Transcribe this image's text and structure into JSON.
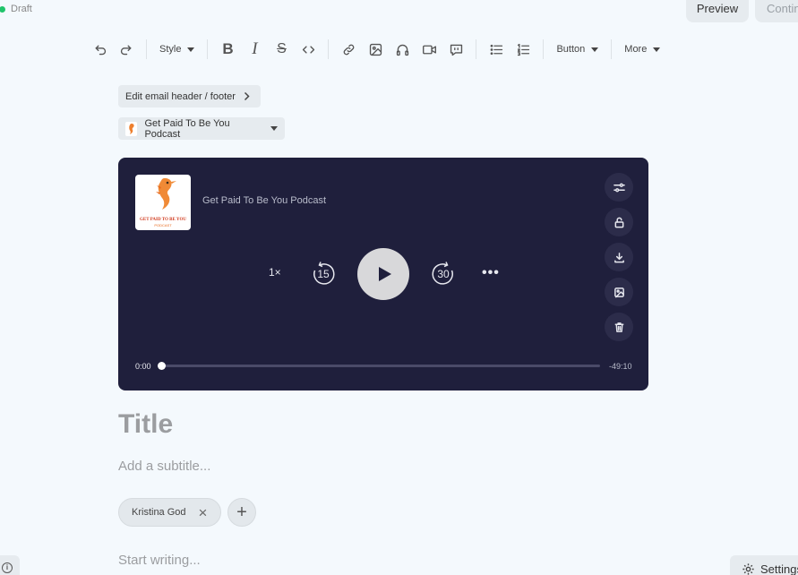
{
  "status": {
    "label": "Draft",
    "dot_color": "#20c46b"
  },
  "header": {
    "preview_label": "Preview",
    "continue_label": "Contin"
  },
  "toolbar": {
    "style_label": "Style",
    "button_label": "Button",
    "more_label": "More",
    "bold_glyph": "B",
    "italic_glyph": "I",
    "strike_glyph": "S",
    "icons": [
      "undo-icon",
      "redo-icon",
      "bold-icon",
      "italic-icon",
      "strikethrough-icon",
      "code-icon",
      "link-icon",
      "image-icon",
      "audio-icon",
      "video-icon",
      "quote-icon",
      "bullet-list-icon",
      "numbered-list-icon"
    ]
  },
  "chips": {
    "edit_header_label": "Edit email header / footer",
    "podcast_label": "Get Paid To Be You Podcast"
  },
  "player": {
    "cover_text": "GET PAID TO BE YOU",
    "cover_sub": "PODCAST",
    "title": "Get Paid To Be You Podcast",
    "speed": "1×",
    "rewind": "15",
    "forward": "30",
    "more": "•••",
    "current_time": "0:00",
    "remaining_time": "-49:10",
    "progress": 0,
    "bg_color": "#1f1f3c"
  },
  "editor": {
    "title_placeholder": "Title",
    "subtitle_placeholder": "Add a subtitle...",
    "author": "Kristina God",
    "author_remove": "×",
    "add_author": "+",
    "body_placeholder": "Start writing..."
  },
  "footer": {
    "info": "i",
    "settings_label": "Settings"
  }
}
